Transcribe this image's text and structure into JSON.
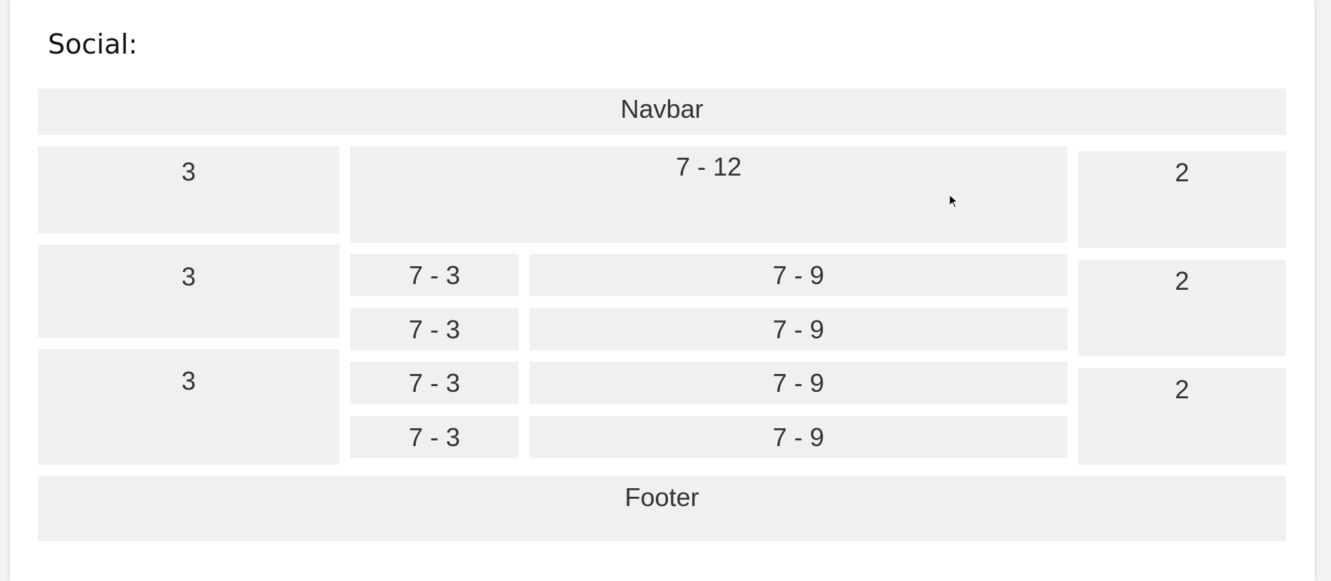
{
  "heading": "Social:",
  "navbar": {
    "label": "Navbar"
  },
  "left_column": {
    "cells": [
      "3",
      "3",
      "3"
    ]
  },
  "main": {
    "top": {
      "label": "7 - 12"
    },
    "rows": [
      {
        "left": "7 - 3",
        "right": "7 - 9"
      },
      {
        "left": "7 - 3",
        "right": "7 - 9"
      },
      {
        "left": "7 - 3",
        "right": "7 - 9"
      },
      {
        "left": "7 - 3",
        "right": "7 - 9"
      }
    ]
  },
  "right_column": {
    "cells": [
      "2",
      "2",
      "2"
    ]
  },
  "footer": {
    "label": "Footer"
  },
  "colors": {
    "page_background": "#ffffff",
    "cell_background": "#f0f0f0",
    "cell_text": "#333333"
  }
}
